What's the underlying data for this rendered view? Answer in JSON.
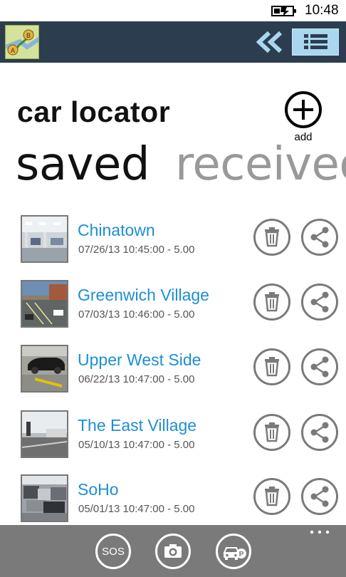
{
  "status_bar": {
    "time": "10:48",
    "battery_icon": "battery-charging-icon"
  },
  "header": {
    "logo_icon": "map-route-logo-icon",
    "back_icon": "double-chevron-left-icon",
    "menu_icon": "list-icon"
  },
  "page": {
    "title": "car locator",
    "add_label": "add"
  },
  "pivot": {
    "items": [
      "saved",
      "received"
    ]
  },
  "locations": [
    {
      "name": "Chinatown",
      "meta": "07/26/13 10:45:00 - 5.00"
    },
    {
      "name": "Greenwich Village",
      "meta": "07/03/13 10:46:00 - 5.00"
    },
    {
      "name": "Upper West Side",
      "meta": "06/22/13 10:47:00 - 5.00"
    },
    {
      "name": "The East Village",
      "meta": "05/10/13 10:47:00 - 5.00"
    },
    {
      "name": "SoHo",
      "meta": "05/01/13 10:47:00 - 5.00"
    }
  ],
  "app_bar": {
    "sos_label": "SOS",
    "camera_icon": "camera-icon",
    "parking_icon": "car-parking-icon",
    "more_icon": "more-dots-icon"
  },
  "colors": {
    "header_bg": "#2c3d4f",
    "accent": "#1d8fd1",
    "menu_button": "#a9d7f0",
    "app_bar_bg": "#7a7a7a"
  }
}
